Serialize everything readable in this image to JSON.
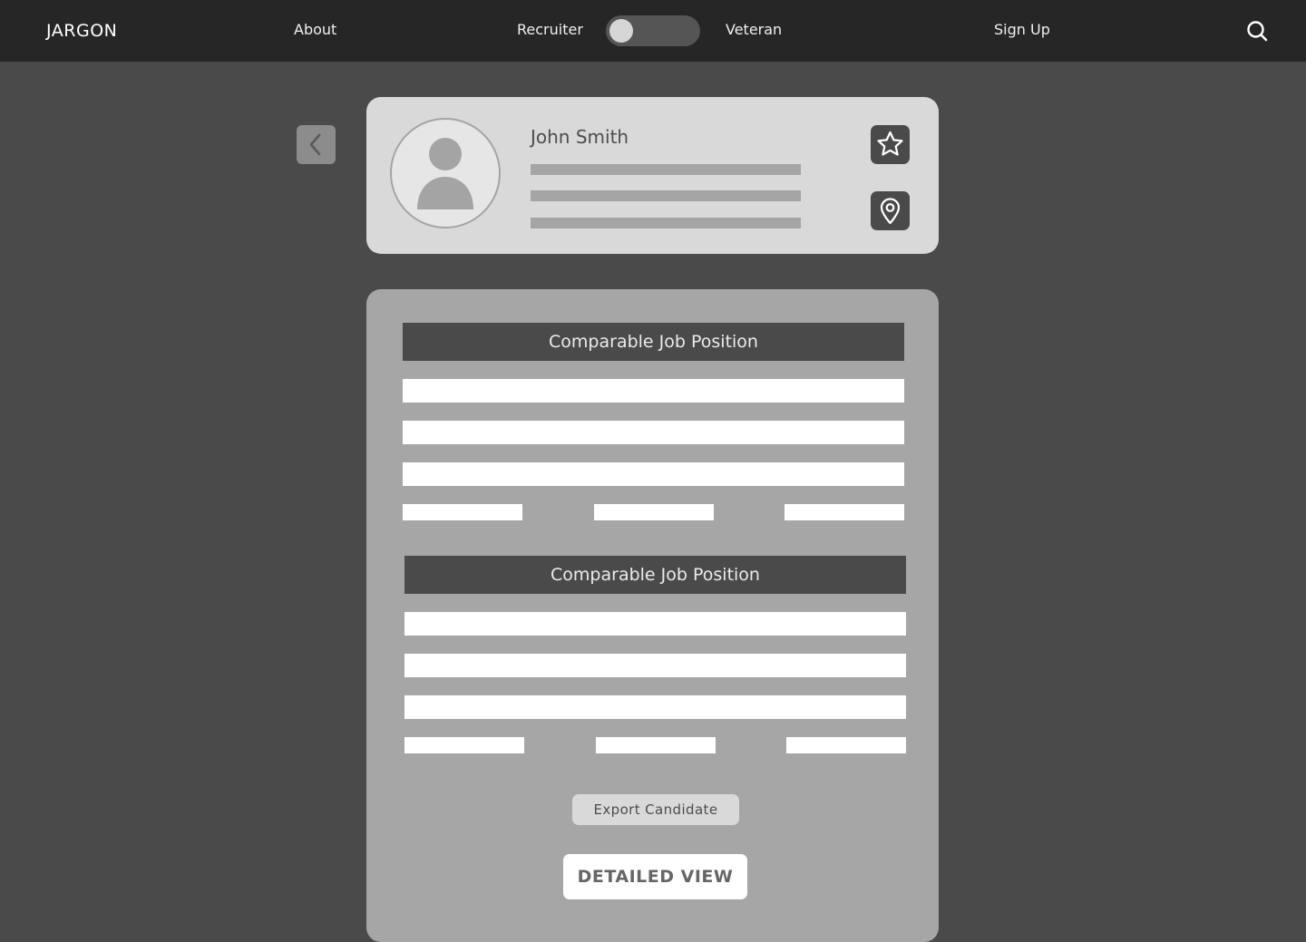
{
  "navbar": {
    "brand": "JARGON",
    "about_label": "About",
    "mode_toggle": {
      "left_label": "Recruiter",
      "right_label": "Veteran",
      "selected": "Recruiter"
    },
    "signup_label": "Sign Up",
    "search_icon": "search-icon"
  },
  "back_button": {
    "icon": "chevron-left-icon"
  },
  "profile": {
    "name": "John Smith",
    "avatar_icon": "user-avatar-icon",
    "favorite_icon": "star-icon",
    "location_icon": "map-pin-icon"
  },
  "job_sections": [
    {
      "title": "Comparable Job Position"
    },
    {
      "title": "Comparable Job Position"
    }
  ],
  "actions": {
    "export_label": "Export Candidate",
    "detailed_view_label": "DETAILED VIEW"
  },
  "colors": {
    "page_background": "#4a4a4a",
    "navbar_background": "#262626",
    "card_background": "#d9d9d9",
    "panel_background": "#a6a6a6",
    "section_header": "#4a4a4a"
  }
}
